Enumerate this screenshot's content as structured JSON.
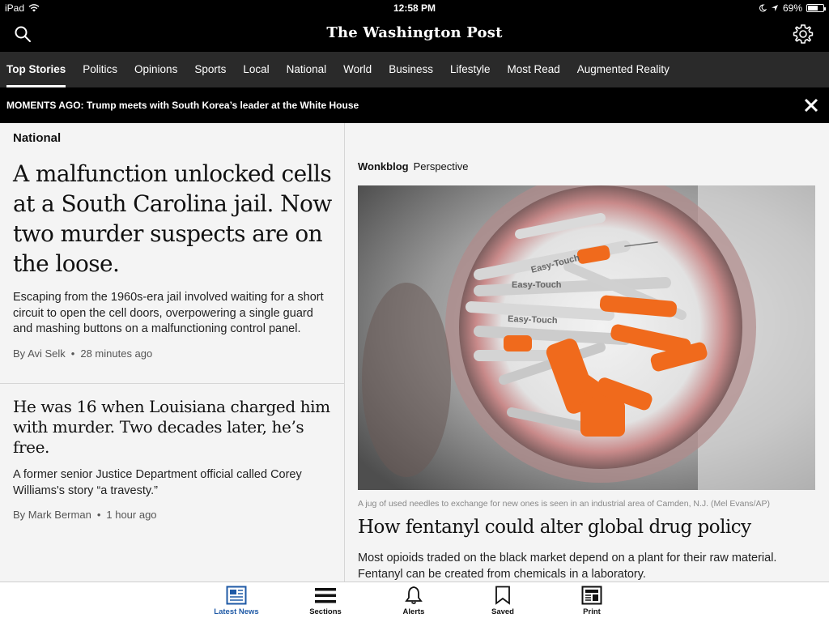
{
  "status_bar": {
    "device": "iPad",
    "time": "12:58 PM",
    "battery": "69%",
    "battery_level": 0.69
  },
  "header": {
    "logo_text": "The Washington Post",
    "search_icon": "search-icon",
    "settings_icon": "gear-icon"
  },
  "nav": {
    "tabs": [
      {
        "label": "Top Stories",
        "active": true
      },
      {
        "label": "Politics"
      },
      {
        "label": "Opinions"
      },
      {
        "label": "Sports"
      },
      {
        "label": "Local"
      },
      {
        "label": "National"
      },
      {
        "label": "World"
      },
      {
        "label": "Business"
      },
      {
        "label": "Lifestyle"
      },
      {
        "label": "Most Read"
      },
      {
        "label": "Augmented Reality"
      }
    ]
  },
  "breaking": {
    "text": "MOMENTS AGO: Trump meets with South Korea’s leader at the White House",
    "close_icon": "close-icon"
  },
  "left": {
    "section": "National",
    "stories": [
      {
        "headline": "A malfunction unlocked cells at a South Carolina jail. Now two murder suspects are on the loose.",
        "blurb": "Escaping from the 1960s-era jail involved waiting for a short circuit to open the cell doors, overpowering a single guard and mashing buttons on a malfunctioning control panel.",
        "author": "By Avi Selk",
        "time": "28 minutes ago"
      },
      {
        "headline": "He was 16 when Louisiana charged him with murder. Two decades later, he’s free.",
        "blurb": "A former senior Justice Department official called Corey Williams's story “a travesty.”",
        "author": "By Mark Berman",
        "time": "1 hour ago"
      }
    ]
  },
  "feature": {
    "brand": "Wonkblog",
    "kicker": "Perspective",
    "caption": "A jug of used needles to exchange for new ones is seen in an industrial area of Camden, N.J. (Mel Evans/AP)",
    "headline": "How fentanyl could alter global drug policy",
    "blurb": "Most opioids traded on the black market depend on a plant for their raw material. Fentanyl can be created from chemicals in a laboratory."
  },
  "tabbar": {
    "items": [
      {
        "label": "Latest News",
        "icon": "newspaper-icon",
        "active": true
      },
      {
        "label": "Sections",
        "icon": "menu-icon"
      },
      {
        "label": "Alerts",
        "icon": "bell-icon"
      },
      {
        "label": "Saved",
        "icon": "bookmark-icon"
      },
      {
        "label": "Print",
        "icon": "print-edition-icon"
      }
    ]
  },
  "colors": {
    "header_bg": "#000000",
    "nav_bg": "#2a2a2a",
    "accent": "#1f5aa6",
    "page_bg": "#f4f4f4"
  }
}
